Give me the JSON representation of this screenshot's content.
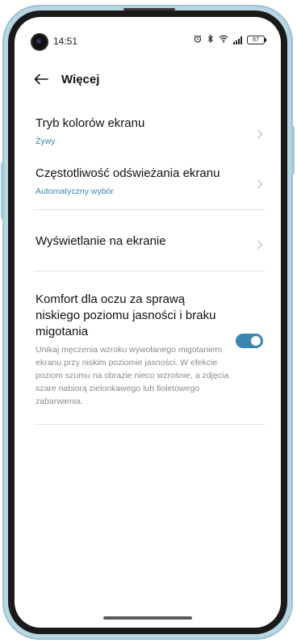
{
  "status_bar": {
    "time": "14:51",
    "battery": "67"
  },
  "header": {
    "title": "Więcej"
  },
  "items": [
    {
      "label": "Tryb kolorów ekranu",
      "sub": "Żywy"
    },
    {
      "label": "Częstotliwość odświeżania ekranu",
      "sub": "Automatyczny wybór"
    },
    {
      "label": "Wyświetlanie na ekranie"
    }
  ],
  "comfort": {
    "title": "Komfort dla oczu za sprawą niskiego poziomu jasności i braku migotania",
    "description": "Unikaj męczenia wzroku wywołanego migotaniem ekranu przy niskim poziomie jasności. W efekcie poziom szumu na obrazie nieco wzrośnie, a zdjęcia szare nabiorą zielonkawego lub fioletowego zabarwienia.",
    "enabled": true
  },
  "colors": {
    "accent": "#3a86b1",
    "frame": "#b9d6e3"
  },
  "icons": [
    "back-arrow-icon",
    "alarm-icon",
    "bluetooth-icon",
    "wifi-icon",
    "signal-icon",
    "battery-icon",
    "chevron-right-icon"
  ]
}
